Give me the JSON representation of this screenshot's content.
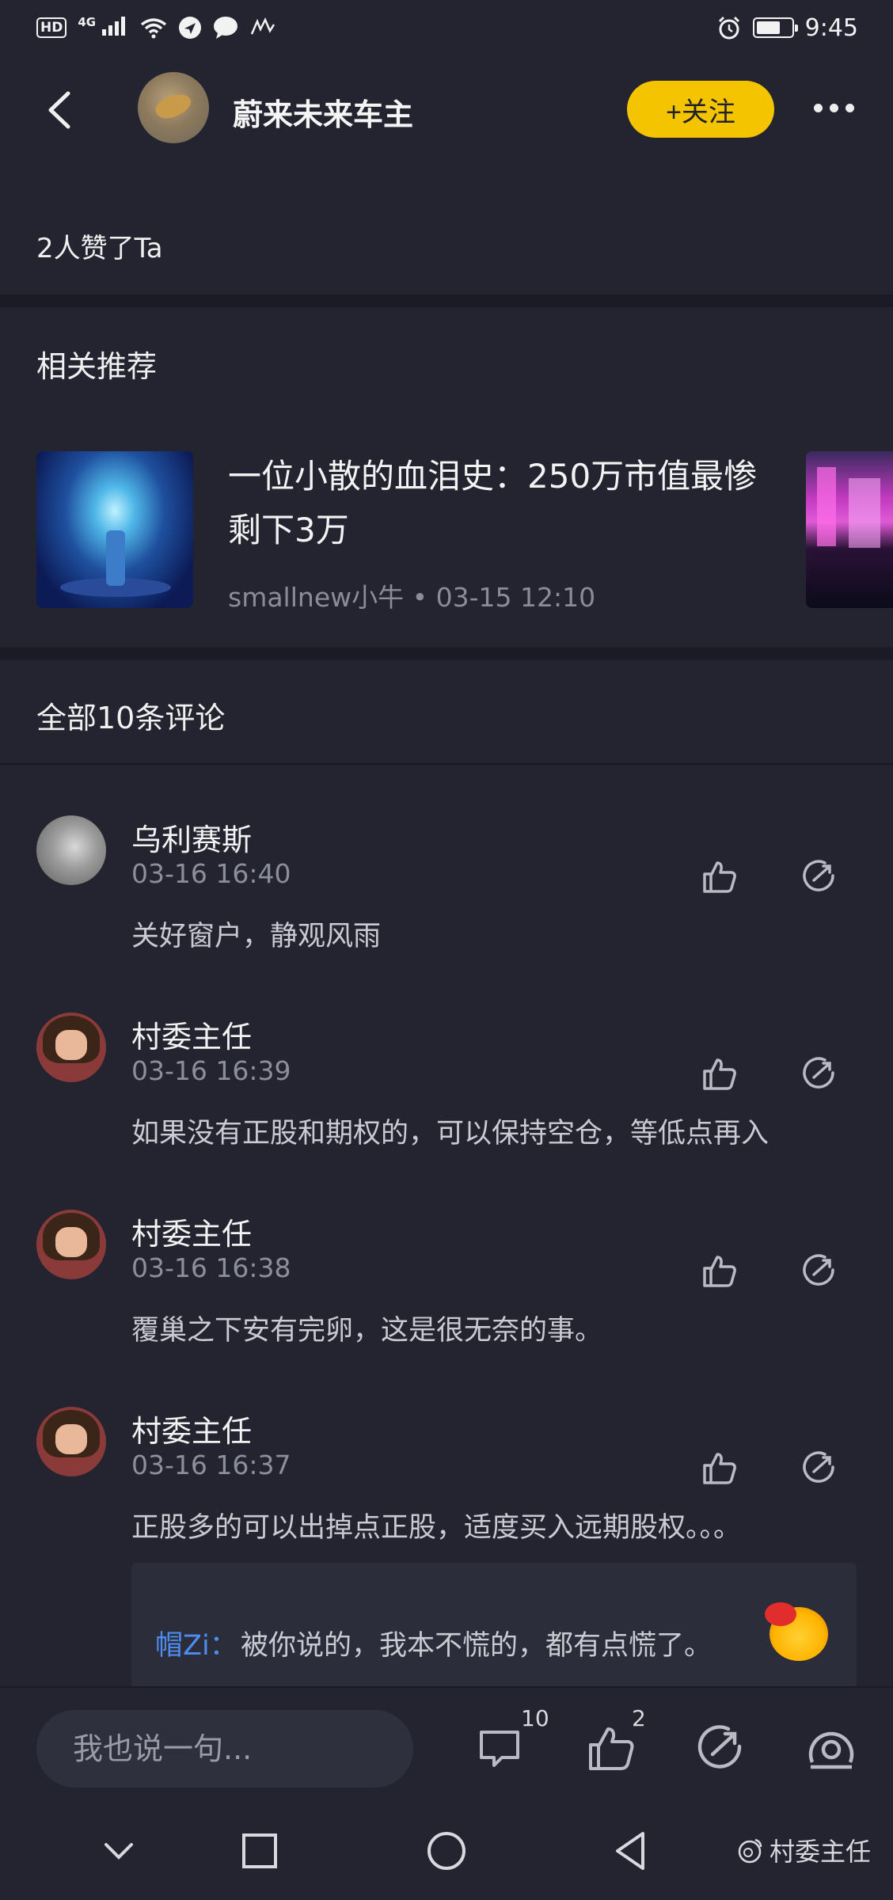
{
  "status_bar": {
    "hd": "HD",
    "network": "4G",
    "time": "9:45",
    "battery_level": 0.7
  },
  "header": {
    "back_icon": "back-chevron",
    "title": "蔚来未来车主",
    "follow_label": "+关注",
    "more_icon": "more-dots"
  },
  "likes_text": "2人赞了Ta",
  "related": {
    "section_title": "相关推荐",
    "item": {
      "title": "一位小散的血泪史：250万市值最惨剩下3万",
      "author": "smallnew小牛",
      "separator": "•",
      "time": "03-15 12:10"
    }
  },
  "comments_section": {
    "title": "全部10条评论",
    "items": [
      {
        "name": "乌利赛斯",
        "time": "03-16 16:40",
        "text": "关好窗户，静观风雨"
      },
      {
        "name": "村委主任",
        "time": "03-16 16:39",
        "text": "如果没有正股和期权的，可以保持空仓，等低点再入"
      },
      {
        "name": "村委主任",
        "time": "03-16 16:38",
        "text": "覆巢之下安有完卵，这是很无奈的事。"
      },
      {
        "name": "村委主任",
        "time": "03-16 16:37",
        "text": "正股多的可以出掉点正股，适度买入远期股权。。。"
      }
    ],
    "reply": {
      "user": "帽Zi",
      "colon": "：",
      "text": "被你说的，我本不慌的，都有点慌了。"
    }
  },
  "bottom_bar": {
    "input_placeholder": "我也说一句...",
    "comment_count": "10",
    "like_count": "2"
  },
  "nav": {
    "watermark": "村委主任"
  },
  "colors": {
    "background": "#232430",
    "accent_yellow": "#f5c400",
    "reply_user_blue": "#4e8df0"
  }
}
